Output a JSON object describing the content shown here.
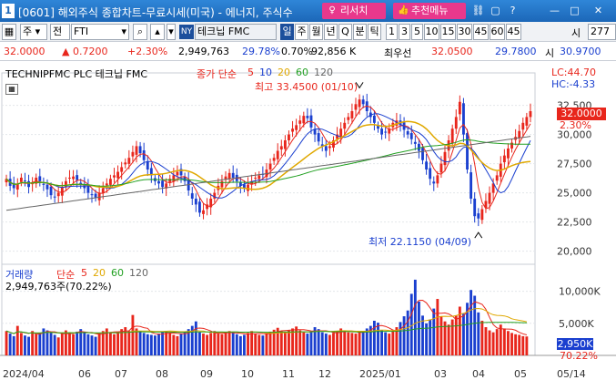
{
  "window": {
    "number": "1",
    "title": "[0601] 해외주식 종합차트-무료시세(미국) - 에너지, 주식수",
    "research_label": "리서치",
    "recommend_label": "추천메뉴",
    "icons": [
      "research-icon",
      "thumbs-up-icon",
      "link-icon",
      "restore-icon",
      "help-icon",
      "minimize-icon",
      "maximize-icon",
      "close-icon"
    ]
  },
  "toolbar": {
    "market": "주",
    "prev": "전",
    "symbol": "FTI",
    "exchange_badge": "NY",
    "name": "테크닙 FMC",
    "periods": [
      "일",
      "주",
      "월",
      "년",
      "Q",
      "분",
      "틱"
    ],
    "active_period": "일",
    "intervals": [
      "1",
      "3",
      "5",
      "10",
      "15",
      "30",
      "45",
      "60",
      "45"
    ],
    "time_label": "시",
    "count": "277"
  },
  "quote": {
    "price": "32.0000",
    "change": "▲ 0.7200",
    "change_pct": "+2.30%",
    "volume": "2,949,763",
    "vol_ratio": "29.78%",
    "turnover": "0.70%",
    "prev_volume": "92,856 K",
    "best_ask_label": "최우선",
    "best_ask": "32.0500",
    "best_bid": "29.7800",
    "low_label": "시",
    "low": "30.9700"
  },
  "chart_header": {
    "name": "TECHNIPFMC PLC  테크닙 FMC",
    "ma_label": "종가 단순",
    "ma_periods": [
      "5",
      "10",
      "20",
      "60",
      "120"
    ],
    "lc": "LC:44.70",
    "hc": "HC:-4.33",
    "high_note": "최고 33.4500 (01/10)",
    "low_note": "최저 22.1150 (04/09)",
    "current_price": "32.0000",
    "current_pct": "2.30%"
  },
  "volume_header": {
    "label": "거래량",
    "ma_label": "단순",
    "ma_periods": [
      "5",
      "20",
      "60",
      "120"
    ],
    "value_text": "2,949,763주(70.22%)",
    "current": "2,950K",
    "current_pct": "70.22%"
  },
  "colors": {
    "up": "#e8261c",
    "down": "#1a3fcf",
    "ma5": "#e8261c",
    "ma10": "#1a3fcf",
    "ma20": "#e0a800",
    "ma60": "#22a022",
    "ma120": "#666666"
  },
  "chart_data": {
    "type": "candlestick",
    "price_axis": [
      "32,500",
      "30,000",
      "27,500",
      "25,000",
      "22,500",
      "20,000"
    ],
    "price_axis_values": [
      32.5,
      30.0,
      27.5,
      25.0,
      22.5,
      20.0
    ],
    "volume_axis": [
      "10,000K",
      "5,000K"
    ],
    "volume_axis_values": [
      10000,
      5000
    ],
    "x_labels": [
      "2024/04",
      "06",
      "07",
      "08",
      "09",
      "10",
      "11",
      "12",
      "2025/01",
      "03",
      "04",
      "05",
      "05/14"
    ],
    "closes": [
      26.2,
      25.6,
      25.4,
      25.8,
      26.3,
      26.0,
      25.5,
      25.9,
      26.3,
      26.0,
      25.7,
      25.3,
      24.8,
      24.6,
      25.0,
      25.5,
      26.0,
      26.3,
      26.4,
      26.1,
      25.7,
      25.4,
      25.0,
      24.8,
      24.6,
      25.0,
      25.4,
      25.8,
      26.2,
      26.5,
      26.8,
      27.2,
      27.6,
      28.0,
      28.5,
      29.0,
      28.4,
      27.8,
      27.0,
      26.5,
      26.0,
      25.8,
      25.5,
      25.8,
      26.2,
      26.5,
      26.8,
      26.5,
      26.0,
      25.2,
      24.5,
      24.0,
      23.3,
      23.5,
      24.0,
      24.5,
      25.0,
      25.6,
      26.0,
      26.4,
      26.7,
      26.3,
      26.0,
      25.6,
      25.4,
      25.7,
      26.0,
      26.3,
      26.5,
      26.6,
      27.0,
      27.5,
      28.0,
      28.6,
      29.0,
      29.5,
      30.0,
      30.5,
      30.8,
      31.2,
      31.6,
      31.4,
      30.6,
      30.0,
      29.4,
      29.0,
      28.6,
      29.0,
      29.5,
      30.0,
      30.5,
      31.0,
      31.5,
      32.0,
      32.6,
      33.0,
      32.6,
      32.0,
      31.5,
      31.0,
      30.5,
      30.0,
      30.2,
      30.5,
      31.0,
      31.2,
      30.8,
      30.4,
      30.0,
      29.6,
      29.2,
      28.6,
      27.8,
      27.0,
      26.2,
      25.8,
      26.5,
      27.5,
      28.5,
      29.5,
      30.5,
      31.5,
      32.8,
      30.0,
      27.0,
      24.5,
      23.0,
      22.8,
      23.6,
      24.3,
      25.0,
      25.8,
      26.5,
      27.5,
      28.2,
      28.8,
      29.3,
      29.8,
      30.3,
      31.0,
      31.5,
      32.0
    ],
    "volumes": [
      3800,
      3400,
      3000,
      4600,
      3500,
      3100,
      2900,
      3800,
      3300,
      3500,
      4200,
      3900,
      3600,
      3200,
      2800,
      3500,
      3900,
      3600,
      3300,
      3700,
      4100,
      3600,
      3300,
      3100,
      2900,
      3500,
      3800,
      4200,
      3500,
      3300,
      3600,
      4100,
      4400,
      3800,
      6300,
      4200,
      3800,
      3500,
      3300,
      3200,
      3100,
      3400,
      3600,
      3800,
      3500,
      3200,
      3000,
      3400,
      3700,
      4100,
      4600,
      5300,
      3600,
      3400,
      3200,
      3500,
      3800,
      3400,
      3300,
      3500,
      3800,
      3600,
      3300,
      3000,
      3200,
      3500,
      3800,
      3400,
      3200,
      3100,
      3400,
      3700,
      4000,
      4300,
      3800,
      3600,
      3900,
      4200,
      4500,
      3900,
      3600,
      3400,
      3700,
      4400,
      4100,
      3600,
      3400,
      3200,
      3500,
      3800,
      4200,
      3900,
      3600,
      3500,
      3400,
      3600,
      3800,
      4200,
      4600,
      5400,
      5100,
      3900,
      3600,
      3400,
      3800,
      4400,
      5200,
      6100,
      7000,
      9600,
      11800,
      8400,
      6200,
      5000,
      5600,
      7300,
      8800,
      6100,
      5300,
      4800,
      5600,
      6200,
      7600,
      6500,
      8200,
      10200,
      9300,
      6700,
      5400,
      4400,
      3900,
      3600,
      4100,
      4800,
      4200,
      3800,
      3500,
      3300,
      3200,
      3000,
      2950
    ]
  }
}
